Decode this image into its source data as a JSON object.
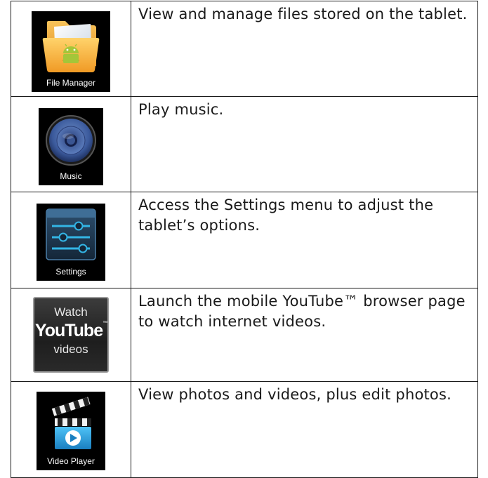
{
  "rows": [
    {
      "icon": "file-manager-folder-icon",
      "icon_label": "File Manager",
      "description": "View and manage files stored on the tablet."
    },
    {
      "icon": "music-speaker-icon",
      "icon_label": "Music",
      "description": "Play music."
    },
    {
      "icon": "settings-sliders-icon",
      "icon_label": "Settings",
      "description": "Access the Settings menu to adjust the tablet’s options."
    },
    {
      "icon": "youtube-watch-videos-icon",
      "icon_label_top": "Watch",
      "icon_label_logo": "YouTube",
      "icon_label_tm": "™",
      "icon_label_bottom": "videos",
      "description": "Launch the mobile YouTube™ browser page to watch internet videos."
    },
    {
      "icon": "video-player-clapper-icon",
      "icon_label": "Video Player",
      "description": "View photos and videos, plus edit photos."
    }
  ],
  "colors": {
    "border": "#1a1a1a",
    "text": "#1a1a1a",
    "tile_background": "#000000",
    "folder_orange": "#f0a030",
    "android_green": "#a4c639",
    "accent_blue": "#33b5e5"
  }
}
